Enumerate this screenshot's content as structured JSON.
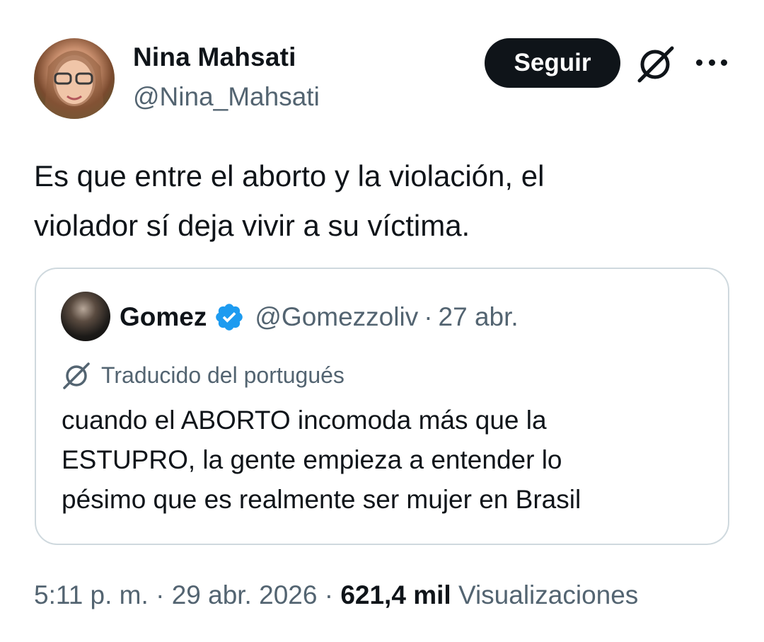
{
  "author": {
    "name": "Nina Mahsati",
    "handle": "@Nina_Mahsati"
  },
  "actions": {
    "follow_label": "Seguir",
    "grok_icon": "grok-icon",
    "more_icon": "more-options-icon"
  },
  "tweet": {
    "line1": "Es que entre el aborto y la violación, el",
    "line2": "violador sí deja vivir a su víctima."
  },
  "quote": {
    "name": "Gomez",
    "verified_icon": "verified-badge-icon",
    "handle": "@Gomezzoliv",
    "separator": "·",
    "date": "27 abr.",
    "translated_label": "Traducido del portugués",
    "line1": "cuando el ABORTO incomoda más que la",
    "line2": "ESTUPRO, la gente empieza a entender lo",
    "line3": "pésimo que es realmente ser mujer en Brasil"
  },
  "meta": {
    "time": "5:11 p. m.",
    "sep1": " · ",
    "date": "29 abr. 2026",
    "sep2": " · ",
    "views_count": "621,4 mil",
    "views_label": "Visualizaciones"
  },
  "colors": {
    "text_primary": "#0f1419",
    "text_secondary": "#536471",
    "border": "#cfd9de",
    "verified": "#1d9bf0",
    "follow_bg": "#0f1419"
  }
}
